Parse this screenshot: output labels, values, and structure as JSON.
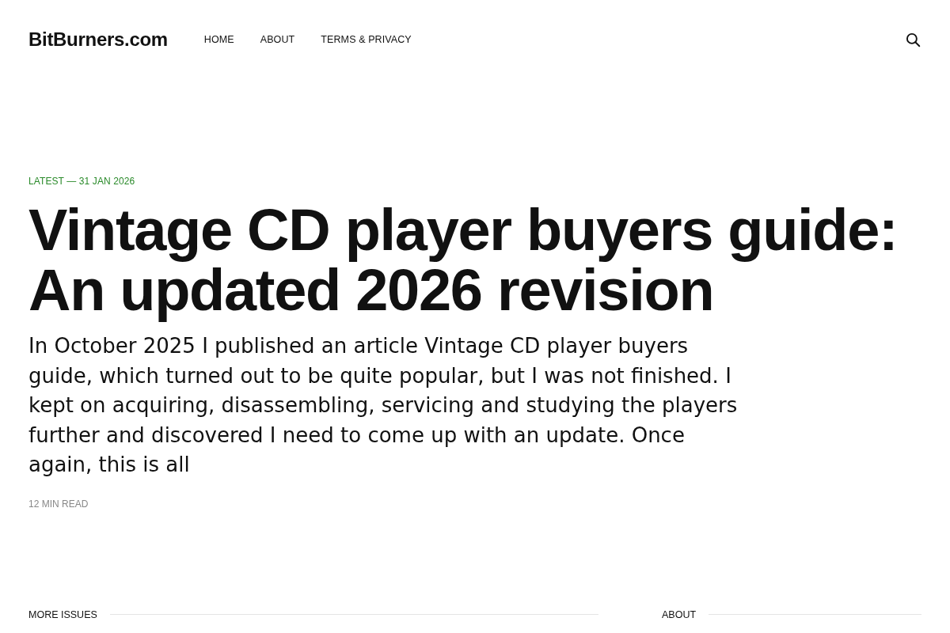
{
  "header": {
    "logo": "BitBurners.com",
    "nav": [
      {
        "label": "HOME"
      },
      {
        "label": "ABOUT"
      },
      {
        "label": "TERMS & PRIVACY"
      }
    ]
  },
  "hero": {
    "tag": "LATEST — 31 JAN 2026",
    "title": "Vintage CD player buyers guide: An updated 2026 revision",
    "excerpt": "In October 2025 I published an article Vintage CD player buyers guide, which turned out to be quite popular, but I was not finished. I kept on acquiring, disassembling, servicing and studying the players further and discovered I need to come up with an update. Once again, this is all",
    "reading_time": "12 MIN READ"
  },
  "sections": [
    {
      "heading": "MORE ISSUES"
    },
    {
      "heading": "ABOUT"
    }
  ]
}
